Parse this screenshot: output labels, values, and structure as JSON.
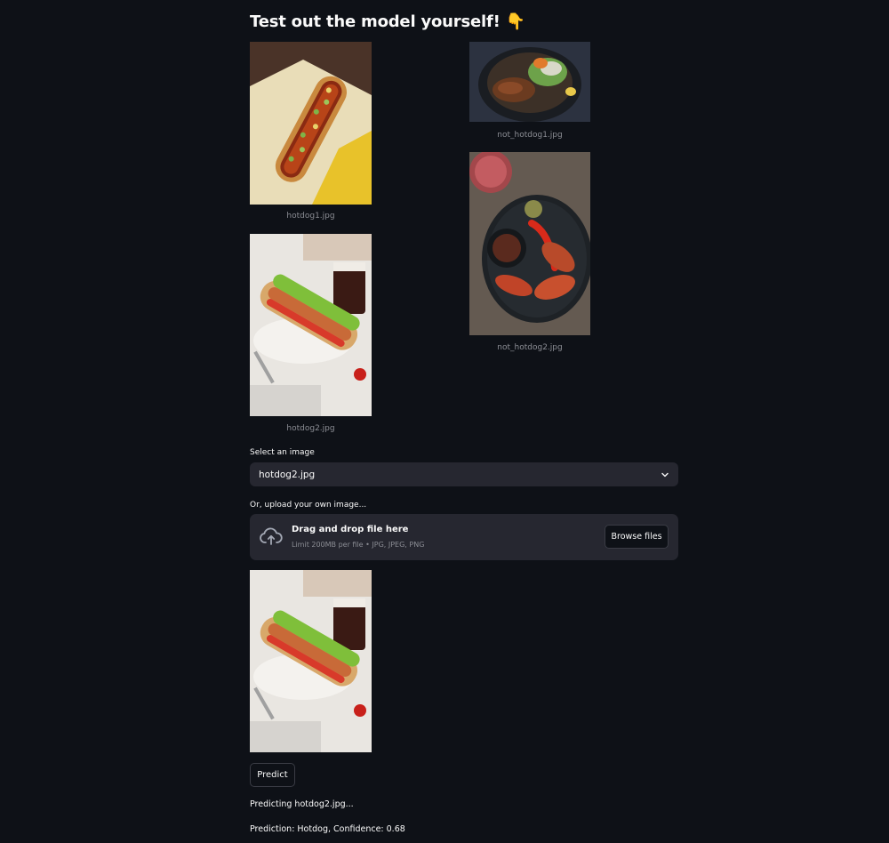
{
  "page": {
    "title": "Test out the model yourself! 👇"
  },
  "gallery": {
    "items": [
      {
        "caption": "hotdog1.jpg"
      },
      {
        "caption": "not_hotdog1.jpg"
      },
      {
        "caption": "hotdog2.jpg"
      },
      {
        "caption": "not_hotdog2.jpg"
      }
    ]
  },
  "select": {
    "label": "Select an image",
    "value": "hotdog2.jpg",
    "chevron_icon": "chevron-down-icon"
  },
  "upload": {
    "label": "Or, upload your own image...",
    "title": "Drag and drop file here",
    "subtitle": "Limit 200MB per file • JPG, JPEG, PNG",
    "browse_label": "Browse files",
    "icon": "cloud-upload-icon"
  },
  "predict": {
    "button_label": "Predict",
    "status_text": "Predicting hotdog2.jpg...",
    "result_text": "Prediction: Hotdog, Confidence: 0.68"
  },
  "colors": {
    "background": "#0e1117",
    "widget": "#262730",
    "muted_text": "#8b8d94"
  }
}
